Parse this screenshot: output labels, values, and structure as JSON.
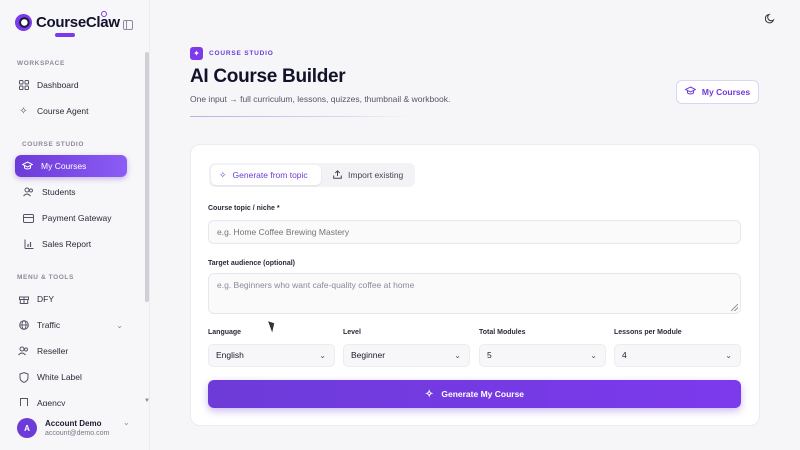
{
  "app": {
    "name": "CourseClaw"
  },
  "sidebar": {
    "sections": [
      {
        "label": "WORKSPACE"
      },
      {
        "label": "COURSE STUDIO"
      },
      {
        "label": "MENU & TOOLS"
      }
    ],
    "items": [
      {
        "label": "Dashboard",
        "icon": "dashboard-icon"
      },
      {
        "label": "Course Agent",
        "icon": "sparkle-icon"
      },
      {
        "label": "My Courses",
        "icon": "graduation-cap-icon",
        "active": true
      },
      {
        "label": "Students",
        "icon": "users-icon"
      },
      {
        "label": "Payment Gateway",
        "icon": "credit-card-icon"
      },
      {
        "label": "Sales Report",
        "icon": "bar-chart-icon"
      },
      {
        "label": "DFY",
        "icon": "gift-icon"
      },
      {
        "label": "Traffic",
        "icon": "globe-icon"
      },
      {
        "label": "Reseller",
        "icon": "users-icon"
      },
      {
        "label": "White Label",
        "icon": "shield-icon"
      },
      {
        "label": "Agency",
        "icon": "building-icon"
      }
    ],
    "account": {
      "initial": "A",
      "name": "Account Demo",
      "email": "account@demo.com"
    }
  },
  "header": {
    "tag": "COURSE STUDIO",
    "title": "AI Course Builder",
    "subtitle": "One input → full curriculum, lessons, quizzes, thumbnail & workbook.",
    "my_courses_label": "My Courses"
  },
  "tabs": [
    {
      "label": "Generate from topic",
      "active": true
    },
    {
      "label": "Import existing",
      "active": false
    }
  ],
  "form": {
    "topic_label": "Course topic / niche *",
    "topic_placeholder": "e.g. Home Coffee Brewing Mastery",
    "audience_label": "Target audience (optional)",
    "audience_placeholder": "e.g. Beginners who want cafe-quality coffee at home",
    "selects": [
      {
        "label": "Language",
        "value": "English"
      },
      {
        "label": "Level",
        "value": "Beginner"
      },
      {
        "label": "Total Modules",
        "value": "5"
      },
      {
        "label": "Lessons per Module",
        "value": "4"
      }
    ],
    "submit_label": "Generate My Course"
  },
  "colors": {
    "accent": "#6d3bd8",
    "accent_light": "#8b5cf6"
  }
}
